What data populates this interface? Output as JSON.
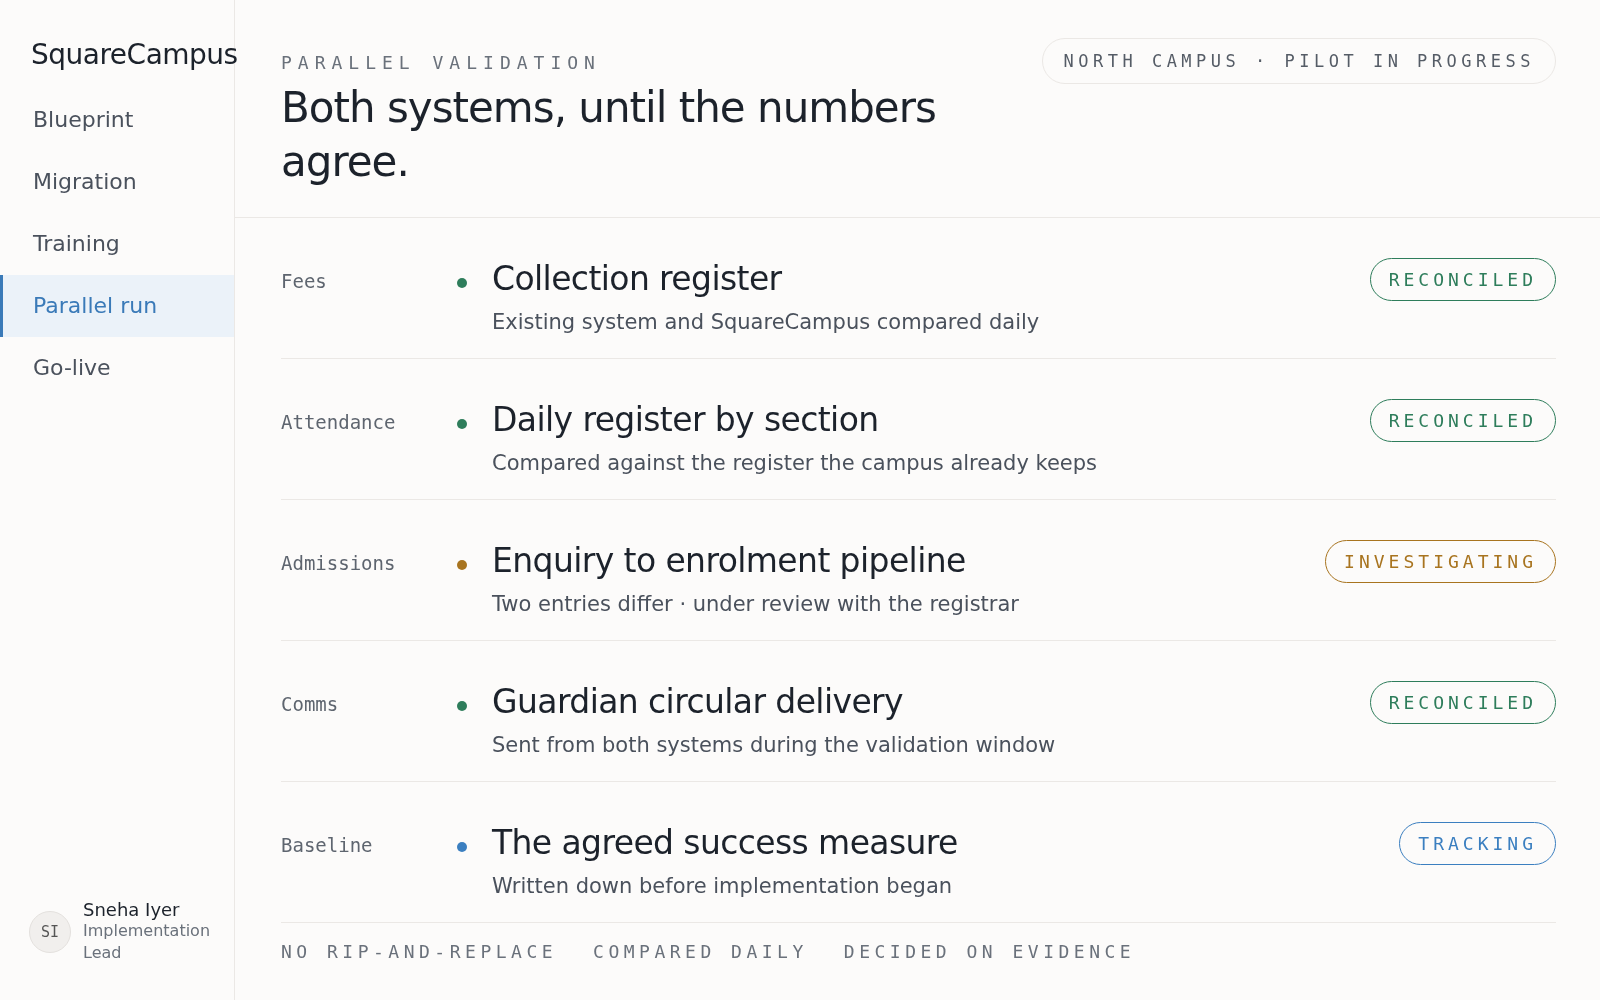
{
  "sidebar": {
    "brand": "SquareCampus",
    "items": [
      {
        "label": "Blueprint",
        "selected": false
      },
      {
        "label": "Migration",
        "selected": false
      },
      {
        "label": "Training",
        "selected": false
      },
      {
        "label": "Parallel run",
        "selected": true
      },
      {
        "label": "Go-live",
        "selected": false
      }
    ],
    "user": {
      "initials": "SI",
      "name": "Sneha Iyer",
      "role": "Implementation Lead"
    }
  },
  "header": {
    "eyebrow": "PARALLEL VALIDATION",
    "title": "Both systems, until the numbers agree.",
    "badge": "NORTH CAMPUS · PILOT IN PROGRESS"
  },
  "rows": [
    {
      "area": "Fees",
      "color": "#2e7d5b",
      "title": "Collection register",
      "detail": "Existing system and SquareCampus compared daily",
      "status": {
        "kind": "reconciled",
        "label": "RECONCILED"
      }
    },
    {
      "area": "Attendance",
      "color": "#2e7d5b",
      "title": "Daily register by section",
      "detail": "Compared against the register the campus already keeps",
      "status": {
        "kind": "reconciled",
        "label": "RECONCILED"
      }
    },
    {
      "area": "Admissions",
      "color": "#a8741f",
      "title": "Enquiry to enrolment pipeline",
      "detail": "Two entries differ · under review with the registrar",
      "status": {
        "kind": "investigating",
        "label": "INVESTIGATING"
      }
    },
    {
      "area": "Comms",
      "color": "#2e7d5b",
      "title": "Guardian circular delivery",
      "detail": "Sent from both systems during the validation window",
      "status": {
        "kind": "reconciled",
        "label": "RECONCILED"
      }
    },
    {
      "area": "Baseline",
      "color": "#3b7fc0",
      "title": "The agreed success measure",
      "detail": "Written down before implementation began",
      "status": {
        "kind": "tracking",
        "label": "TRACKING"
      }
    }
  ],
  "footer": [
    "NO RIP-AND-REPLACE",
    "COMPARED DAILY",
    "DECIDED ON EVIDENCE"
  ]
}
